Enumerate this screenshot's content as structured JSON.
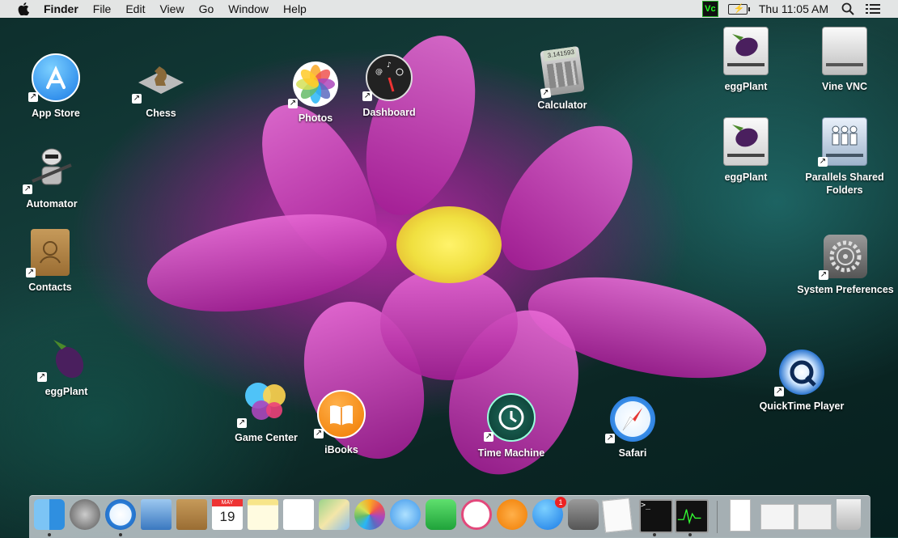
{
  "menubar": {
    "app": "Finder",
    "menus": [
      "File",
      "Edit",
      "View",
      "Go",
      "Window",
      "Help"
    ],
    "clock": "Thu 11:05 AM",
    "status_icons": [
      "vnc-icon",
      "battery-charging-icon",
      "spotlight-icon",
      "notification-center-icon"
    ],
    "vnc_text": "Vc"
  },
  "desktop": {
    "icons": {
      "app_store": "App Store",
      "chess": "Chess",
      "photos": "Photos",
      "dashboard": "Dashboard",
      "calculator": "Calculator",
      "automator": "Automator",
      "contacts": "Contacts",
      "eggplant_left": "eggPlant",
      "game_center": "Game Center",
      "ibooks": "iBooks",
      "time_machine": "Time Machine",
      "safari": "Safari",
      "quicktime": "QuickTime Player",
      "eggplant_1": "eggPlant",
      "vine_vnc": "Vine VNC",
      "eggplant_2": "eggPlant",
      "parallels": "Parallels Shared Folders",
      "system_prefs": "System Preferences"
    },
    "calculator_display": "3.141593"
  },
  "dock": {
    "items": [
      "Finder",
      "Launchpad",
      "Safari",
      "Mail",
      "Contacts",
      "Calendar",
      "Notes",
      "Reminders",
      "Maps",
      "Photos",
      "Messages",
      "FaceTime",
      "iTunes",
      "iBooks",
      "App Store",
      "System Preferences",
      "TextEdit",
      "Terminal",
      "Activity Monitor",
      "Trash"
    ],
    "calendar_month": "MAY",
    "calendar_day": "19",
    "app_store_badge": "1"
  },
  "colors": {
    "menubar_bg": "#ececec",
    "desktop_bg": "#153f3c",
    "flower": "#c22fb3"
  }
}
